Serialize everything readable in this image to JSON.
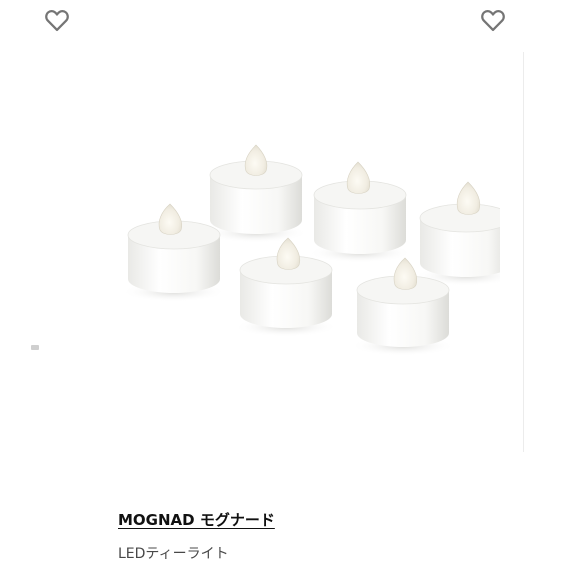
{
  "favorites": {
    "left_icon": "heart-outline-icon",
    "right_icon": "heart-outline-icon",
    "icon_color": "#757575"
  },
  "product": {
    "name": "MOGNAD モグナード",
    "description": "LEDティーライト",
    "image_subject": "six white LED tealight candles"
  }
}
